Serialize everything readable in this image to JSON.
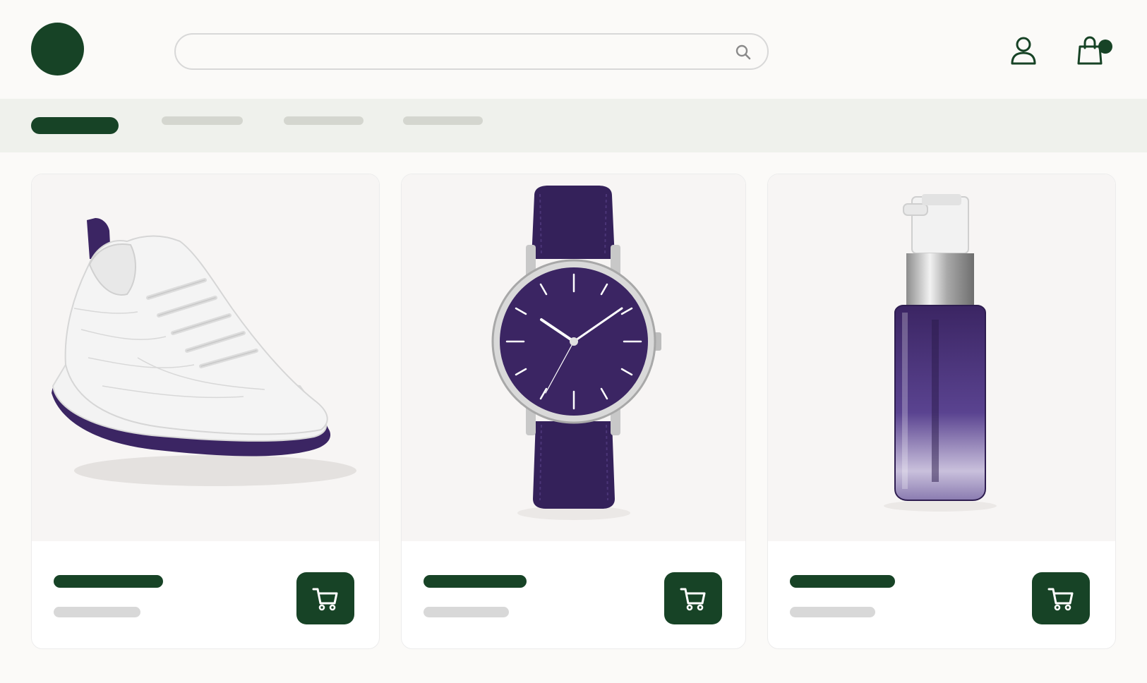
{
  "search": {
    "placeholder": "",
    "value": ""
  },
  "colors": {
    "brand": "#174326",
    "background": "#fbfaf8",
    "nav_background": "#eff1ec",
    "placeholder_bar": "#d8d8d8",
    "product_accent": "#3b2563"
  },
  "header": {
    "icons": [
      "search-icon",
      "user-icon",
      "shopping-bag-icon"
    ],
    "cart_badge_visible": true
  },
  "nav": {
    "tabs": [
      {
        "label": "",
        "active": true
      },
      {
        "label": "",
        "active": false
      },
      {
        "label": "",
        "active": false
      },
      {
        "label": "",
        "active": false
      }
    ]
  },
  "products": [
    {
      "image": "sneaker",
      "name": "",
      "price": "",
      "action_icon": "cart-icon"
    },
    {
      "image": "wristwatch",
      "name": "",
      "price": "",
      "action_icon": "cart-icon"
    },
    {
      "image": "serum-bottle",
      "name": "",
      "price": "",
      "action_icon": "cart-icon"
    }
  ]
}
